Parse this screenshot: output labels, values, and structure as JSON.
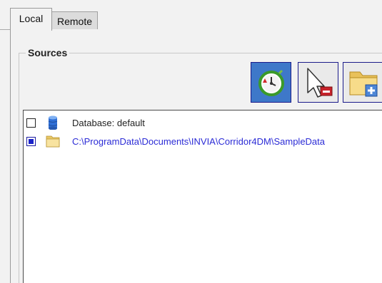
{
  "tabs": [
    {
      "label": "Local",
      "active": true
    },
    {
      "label": "Remote",
      "active": false
    }
  ],
  "sources": {
    "title": "Sources",
    "toolbar": [
      {
        "icon": "refresh-clock-icon",
        "accent": "#3e78c9"
      },
      {
        "icon": "remove-source-icon"
      },
      {
        "icon": "add-folder-icon"
      }
    ],
    "items": [
      {
        "checked": false,
        "icon": "database-icon",
        "label": "Database: default",
        "color": "#222222"
      },
      {
        "checked": true,
        "icon": "folder-icon",
        "label": "C:\\ProgramData\\Documents\\INVIA\\Corridor4DM\\SampleData",
        "color": "#2b2bd6"
      }
    ]
  }
}
